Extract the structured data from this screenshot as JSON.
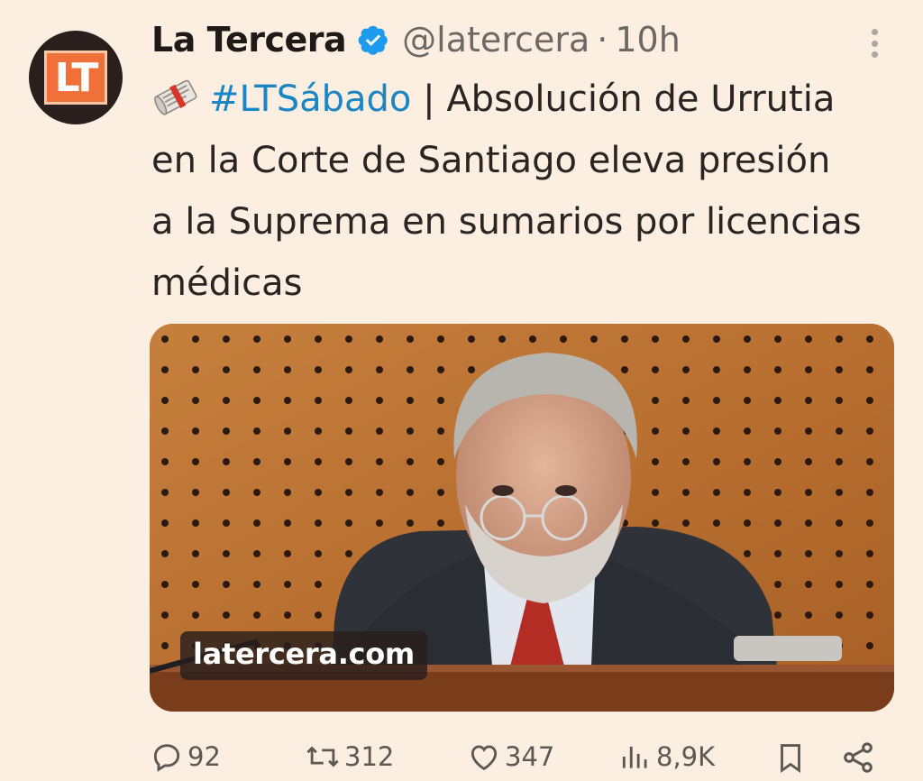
{
  "account": {
    "name": "La Tercera",
    "handle": "@latercera",
    "separator": "·",
    "time": "10h",
    "avatar_text": "LT"
  },
  "tweet": {
    "hashtag": "#LTSábado",
    "text": " | Absolución de Urrutia en la Corte de Santiago eleva presión a la Suprema en sumarios por licencias médicas",
    "emoji": "newspaper-roll-emoji"
  },
  "media": {
    "source_domain": "latercera.com"
  },
  "actions": {
    "replies": "92",
    "retweets": "312",
    "likes": "347",
    "views": "8,9K"
  },
  "colors": {
    "background": "#fcefe1",
    "hashtag": "#1b86c4",
    "verified": "#1d9bf0",
    "avatar_accent": "#f0703a"
  }
}
